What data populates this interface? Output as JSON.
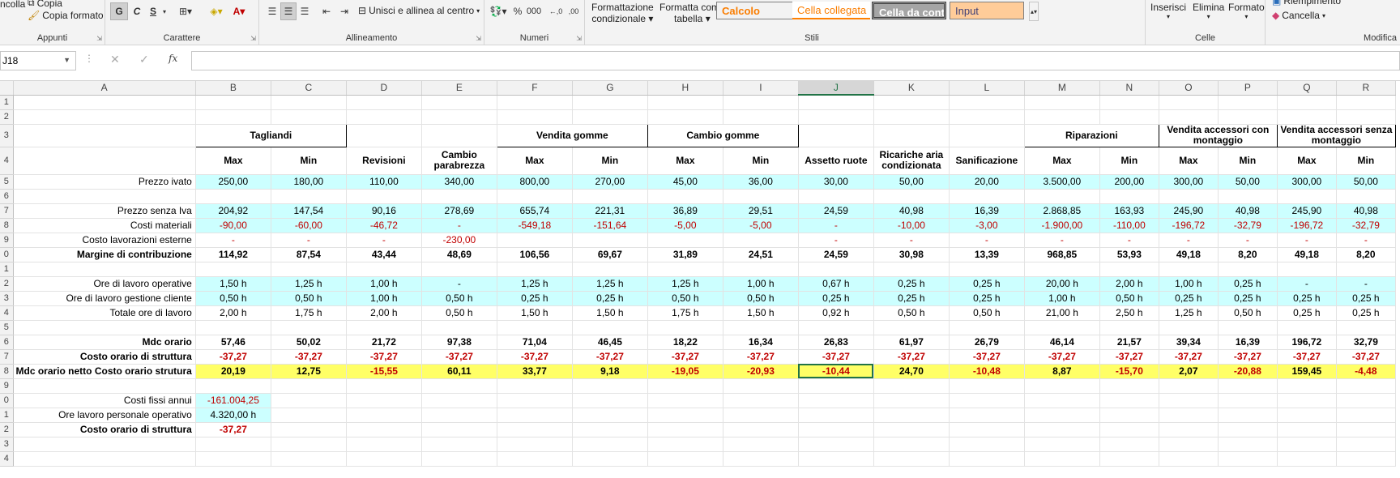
{
  "ribbon": {
    "clipboard": {
      "title": "Appunti",
      "incolla": "ncolla",
      "copia": "Copia",
      "copia_formato": "Copia formato"
    },
    "carattere": {
      "title": "Carattere",
      "g": "G",
      "c": "C",
      "s": "S"
    },
    "allineamento": {
      "title": "Allineamento",
      "unisci": "Unisci e allinea al centro"
    },
    "numeri": {
      "title": "Numeri",
      "percent": "%",
      "thousands": "000",
      "inc": "←,0",
      "dec": ",00"
    },
    "stili": {
      "title": "Stili",
      "formattazione": "Formattazione",
      "condizionale": "condizionale",
      "formatta": "Formatta come",
      "tabella": "tabella",
      "calcolo": "Calcolo",
      "cella_collegata": "Cella collegata",
      "cella_da": "Cella da cont...",
      "input": "Input"
    },
    "celle": {
      "title": "Celle",
      "inserisci": "Inserisci",
      "elimina": "Elimina",
      "formato": "Formato"
    },
    "modifica": {
      "title": "Modifica",
      "riempimento": "Riempimento",
      "cancella": "Cancella"
    }
  },
  "formula_bar": {
    "name_box": "J18",
    "fx": "fx",
    "formula": ""
  },
  "columns": [
    "A",
    "B",
    "C",
    "D",
    "E",
    "F",
    "G",
    "H",
    "I",
    "J",
    "K",
    "L",
    "M",
    "N",
    "O",
    "P",
    "Q",
    "R"
  ],
  "selected_column": "J",
  "rows": {
    "r1": "1",
    "r2": "2",
    "r3": "3",
    "r4": "4",
    "r5": "5",
    "r6": "6",
    "r7": "7",
    "r8": "8",
    "r9": "9",
    "r10": "0",
    "r11": "1",
    "r12": "2",
    "r13": "3",
    "r14": "4",
    "r15": "5",
    "r16": "6",
    "r17": "7",
    "r18": "8",
    "r19": "9",
    "r20": "0",
    "r21": "1",
    "r22": "2",
    "r23": "3",
    "r24": "4"
  },
  "headers": {
    "tagliandi": "Tagliandi",
    "vendita_gomme": "Vendita gomme",
    "cambio_gomme": "Cambio gomme",
    "riparazioni": "Riparazioni",
    "vendita_acc_con": "Vendita accessori con montaggio",
    "vendita_acc_senza": "Vendita accessori senza montaggio",
    "max": "Max",
    "min": "Min",
    "revisioni": "Revisioni",
    "cambio_parabrezza": "Cambio parabrezza",
    "assetto_ruote": "Assetto ruote",
    "ricariche": "Ricariche aria condizionata",
    "sanificazione": "Sanificazione"
  },
  "data": {
    "prezzo_ivato": {
      "label": "Prezzo ivato",
      "v": [
        "250,00",
        "180,00",
        "110,00",
        "340,00",
        "800,00",
        "270,00",
        "45,00",
        "36,00",
        "30,00",
        "50,00",
        "20,00",
        "3.500,00",
        "200,00",
        "300,00",
        "50,00",
        "300,00",
        "50,00"
      ]
    },
    "prezzo_senza_iva": {
      "label": "Prezzo senza Iva",
      "v": [
        "204,92",
        "147,54",
        "90,16",
        "278,69",
        "655,74",
        "221,31",
        "36,89",
        "29,51",
        "24,59",
        "40,98",
        "16,39",
        "2.868,85",
        "163,93",
        "245,90",
        "40,98",
        "245,90",
        "40,98"
      ]
    },
    "costi_materiali": {
      "label": "Costi materiali",
      "v": [
        "-90,00",
        "-60,00",
        "-46,72",
        "-",
        "-549,18",
        "-151,64",
        "-5,00",
        "-5,00",
        "-",
        "-10,00",
        "-3,00",
        "-1.900,00",
        "-110,00",
        "-196,72",
        "-32,79",
        "-196,72",
        "-32,79"
      ]
    },
    "costo_lav_esterne": {
      "label": "Costo lavorazioni esterne",
      "v": [
        "-",
        "-",
        "-",
        "-230,00",
        "",
        "",
        "",
        "",
        "-",
        "-",
        "-",
        "-",
        "-",
        "-",
        "-",
        "-",
        "-"
      ]
    },
    "margine": {
      "label": "Margine di contribuzione",
      "v": [
        "114,92",
        "87,54",
        "43,44",
        "48,69",
        "106,56",
        "69,67",
        "31,89",
        "24,51",
        "24,59",
        "30,98",
        "13,39",
        "968,85",
        "53,93",
        "49,18",
        "8,20",
        "49,18",
        "8,20"
      ]
    },
    "ore_operative": {
      "label": "Ore di lavoro operative",
      "v": [
        "1,50 h",
        "1,25 h",
        "1,00 h",
        "-",
        "1,25 h",
        "1,25 h",
        "1,25 h",
        "1,00 h",
        "0,67 h",
        "0,25 h",
        "0,25 h",
        "20,00 h",
        "2,00 h",
        "1,00 h",
        "0,25 h",
        "-",
        "-"
      ]
    },
    "ore_gestione": {
      "label": "Ore di lavoro gestione cliente",
      "v": [
        "0,50 h",
        "0,50 h",
        "1,00 h",
        "0,50 h",
        "0,25 h",
        "0,25 h",
        "0,50 h",
        "0,50 h",
        "0,25 h",
        "0,25 h",
        "0,25 h",
        "1,00 h",
        "0,50 h",
        "0,25 h",
        "0,25 h",
        "0,25 h",
        "0,25 h"
      ]
    },
    "totale_ore": {
      "label": "Totale ore di lavoro",
      "v": [
        "2,00 h",
        "1,75 h",
        "2,00 h",
        "0,50 h",
        "1,50 h",
        "1,50 h",
        "1,75 h",
        "1,50 h",
        "0,92 h",
        "0,50 h",
        "0,50 h",
        "21,00 h",
        "2,50 h",
        "1,25 h",
        "0,50 h",
        "0,25 h",
        "0,25 h"
      ]
    },
    "mdc_orario": {
      "label": "Mdc orario",
      "v": [
        "57,46",
        "50,02",
        "21,72",
        "97,38",
        "71,04",
        "46,45",
        "18,22",
        "16,34",
        "26,83",
        "61,97",
        "26,79",
        "46,14",
        "21,57",
        "39,34",
        "16,39",
        "196,72",
        "32,79"
      ]
    },
    "costo_orario_struttura": {
      "label": "Costo orario di struttura",
      "v": [
        "-37,27",
        "-37,27",
        "-37,27",
        "-37,27",
        "-37,27",
        "-37,27",
        "-37,27",
        "-37,27",
        "-37,27",
        "-37,27",
        "-37,27",
        "-37,27",
        "-37,27",
        "-37,27",
        "-37,27",
        "-37,27",
        "-37,27"
      ]
    },
    "mdc_netto": {
      "label": "Mdc orario netto Costo orario strutura",
      "v": [
        "20,19",
        "12,75",
        "-15,55",
        "60,11",
        "33,77",
        "9,18",
        "-19,05",
        "-20,93",
        "-10,44",
        "24,70",
        "-10,48",
        "8,87",
        "-15,70",
        "2,07",
        "-20,88",
        "159,45",
        "-4,48"
      ]
    },
    "costi_fissi": {
      "label": "Costi fissi annui",
      "v": "-161.004,25"
    },
    "ore_personale": {
      "label": "Ore lavoro personale operativo",
      "v": "4.320,00 h"
    },
    "costo_struttura": {
      "label": "Costo orario di struttura",
      "v": "-37,27"
    }
  }
}
